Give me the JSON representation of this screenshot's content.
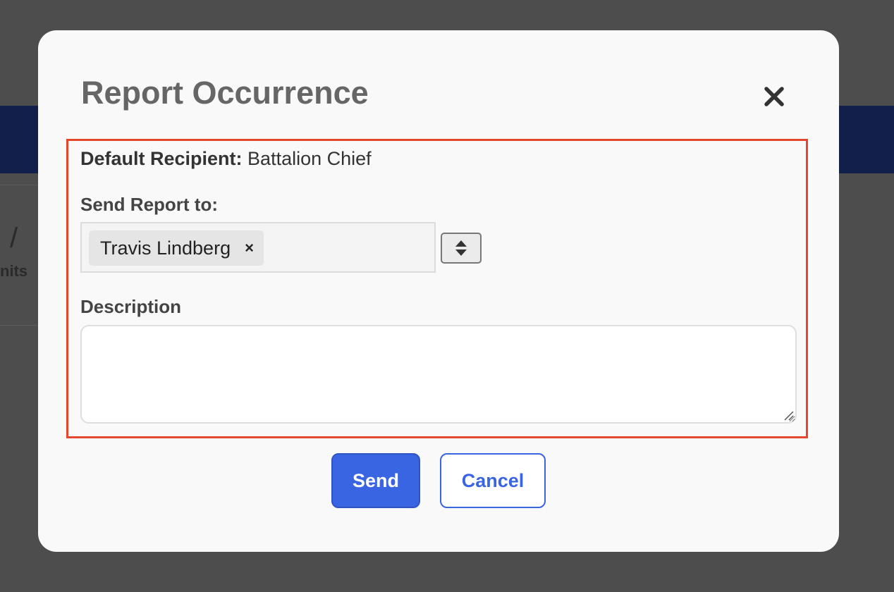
{
  "background": {
    "partial_slash": "/",
    "partial_label": "nits"
  },
  "modal": {
    "title": "Report Occurrence",
    "close_icon": "close-icon",
    "default_recipient": {
      "label": "Default Recipient:",
      "value": "Battalion Chief"
    },
    "send_report_to": {
      "label": "Send Report to:",
      "selected": [
        {
          "name": "Travis Lindberg",
          "remove_glyph": "×"
        }
      ],
      "stepper_icon": "up-down-chevron-icon"
    },
    "description": {
      "label": "Description",
      "value": ""
    },
    "buttons": {
      "send_label": "Send",
      "cancel_label": "Cancel"
    }
  },
  "colors": {
    "accent": "#3965e3",
    "highlight": "#e5472e",
    "title": "#666666",
    "overlay": "#4d4d4d",
    "background_band": "#111f4a"
  }
}
